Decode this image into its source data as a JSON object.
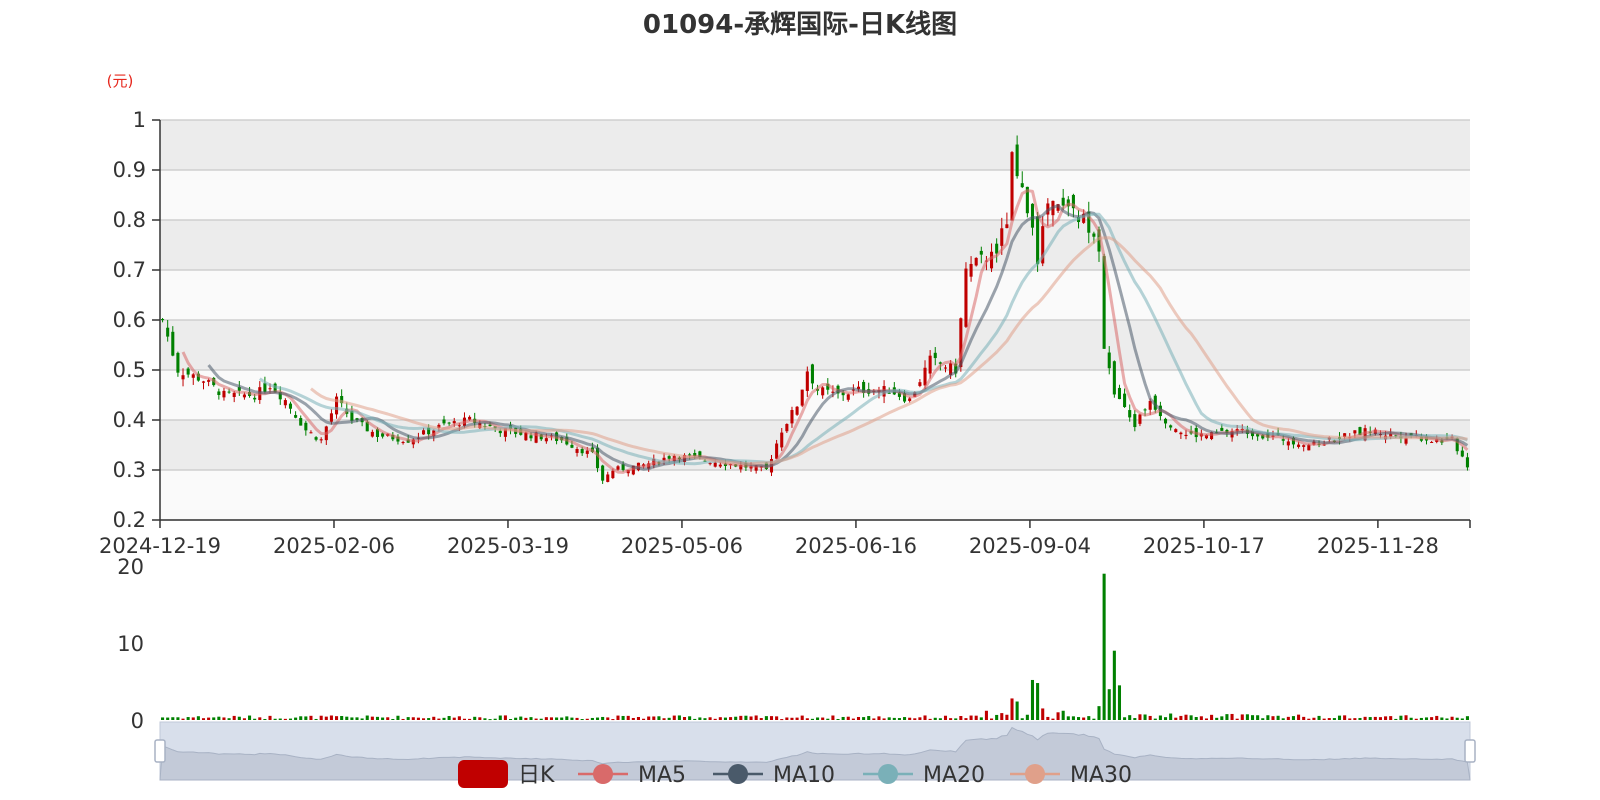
{
  "chart_data": {
    "type": "candlestick",
    "title": "01094-承辉国际-日K线图",
    "unit_label": "(元)",
    "price_axis": {
      "min": 0.2,
      "max": 1,
      "ticks": [
        "0.2",
        "0.3",
        "0.4",
        "0.5",
        "0.6",
        "0.7",
        "0.8",
        "0.9",
        "1"
      ]
    },
    "volume_axis": {
      "min": 0,
      "max": 20,
      "ticks": [
        "0",
        "10",
        "20"
      ]
    },
    "x_ticks": [
      {
        "label": "2024-12-19",
        "index": 0
      },
      {
        "label": "2025-02-06",
        "index": 34
      },
      {
        "label": "2025-03-19",
        "index": 68
      },
      {
        "label": "2025-05-06",
        "index": 102
      },
      {
        "label": "2025-06-16",
        "index": 136
      },
      {
        "label": "2025-09-04",
        "index": 170
      },
      {
        "label": "2025-10-17",
        "index": 204
      },
      {
        "label": "2025-11-28",
        "index": 238
      }
    ],
    "bar_count": 256,
    "series": [
      {
        "name": "日K",
        "color": "#c00000"
      },
      {
        "name": "MA5",
        "color": "#d96a6a"
      },
      {
        "name": "MA10",
        "color": "#4a5a6a"
      },
      {
        "name": "MA20",
        "color": "#7ab0b8"
      },
      {
        "name": "MA30",
        "color": "#e0a08a"
      }
    ],
    "up_color": "#c00000",
    "down_color": "#008000",
    "close_anchors": [
      [
        0,
        0.6
      ],
      [
        3,
        0.5
      ],
      [
        8,
        0.48
      ],
      [
        12,
        0.45
      ],
      [
        18,
        0.45
      ],
      [
        21,
        0.47
      ],
      [
        24,
        0.44
      ],
      [
        28,
        0.38
      ],
      [
        31,
        0.36
      ],
      [
        34,
        0.44
      ],
      [
        37,
        0.4
      ],
      [
        42,
        0.37
      ],
      [
        48,
        0.36
      ],
      [
        55,
        0.39
      ],
      [
        60,
        0.4
      ],
      [
        66,
        0.38
      ],
      [
        72,
        0.37
      ],
      [
        78,
        0.36
      ],
      [
        84,
        0.33
      ],
      [
        86,
        0.28
      ],
      [
        88,
        0.3
      ],
      [
        94,
        0.31
      ],
      [
        100,
        0.33
      ],
      [
        106,
        0.32
      ],
      [
        112,
        0.31
      ],
      [
        118,
        0.3
      ],
      [
        121,
        0.38
      ],
      [
        124,
        0.43
      ],
      [
        126,
        0.5
      ],
      [
        128,
        0.46
      ],
      [
        132,
        0.45
      ],
      [
        136,
        0.46
      ],
      [
        142,
        0.46
      ],
      [
        146,
        0.44
      ],
      [
        150,
        0.52
      ],
      [
        155,
        0.5
      ],
      [
        157,
        0.7
      ],
      [
        160,
        0.72
      ],
      [
        163,
        0.74
      ],
      [
        165,
        0.8
      ],
      [
        166,
        0.92
      ],
      [
        168,
        0.85
      ],
      [
        170,
        0.8
      ],
      [
        171,
        0.72
      ],
      [
        173,
        0.83
      ],
      [
        176,
        0.82
      ],
      [
        180,
        0.8
      ],
      [
        182,
        0.78
      ],
      [
        183,
        0.75
      ],
      [
        184,
        0.55
      ],
      [
        186,
        0.45
      ],
      [
        188,
        0.42
      ],
      [
        190,
        0.39
      ],
      [
        193,
        0.44
      ],
      [
        196,
        0.4
      ],
      [
        200,
        0.37
      ],
      [
        205,
        0.37
      ],
      [
        210,
        0.38
      ],
      [
        215,
        0.37
      ],
      [
        220,
        0.36
      ],
      [
        225,
        0.35
      ],
      [
        228,
        0.36
      ],
      [
        232,
        0.37
      ],
      [
        236,
        0.38
      ],
      [
        240,
        0.37
      ],
      [
        244,
        0.37
      ],
      [
        248,
        0.36
      ],
      [
        252,
        0.36
      ],
      [
        255,
        0.31
      ]
    ],
    "volume_anchors": [
      [
        0,
        0.4
      ],
      [
        160,
        0.4
      ],
      [
        161,
        1.2
      ],
      [
        162,
        0.6
      ],
      [
        165,
        0.8
      ],
      [
        166,
        2.8
      ],
      [
        167,
        2.4
      ],
      [
        168,
        0.4
      ],
      [
        169,
        0.6
      ],
      [
        170,
        5.2
      ],
      [
        171,
        4.8
      ],
      [
        172,
        1.5
      ],
      [
        173,
        0.4
      ],
      [
        174,
        0.3
      ],
      [
        175,
        1.0
      ],
      [
        176,
        1.2
      ],
      [
        177,
        0.4
      ],
      [
        182,
        0.4
      ],
      [
        183,
        1.8
      ],
      [
        184,
        19.0
      ],
      [
        185,
        4.0
      ],
      [
        186,
        9.0
      ],
      [
        187,
        4.5
      ],
      [
        188,
        0.6
      ],
      [
        255,
        0.4
      ]
    ]
  }
}
